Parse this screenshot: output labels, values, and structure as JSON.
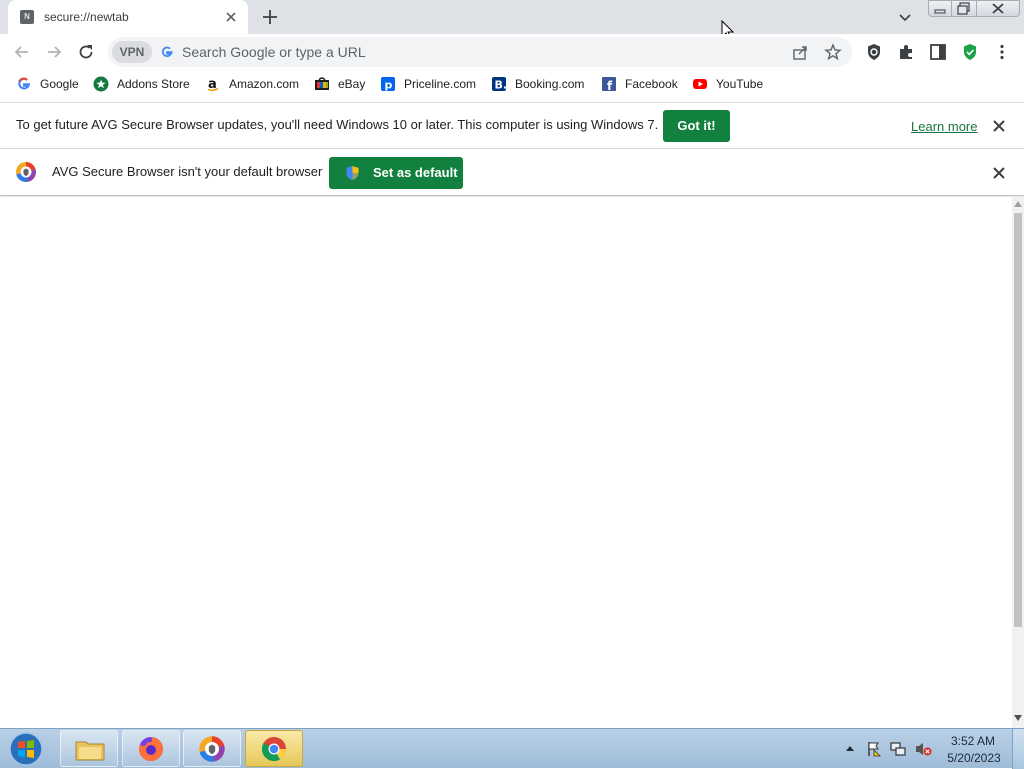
{
  "tab": {
    "title": "secure://newtab",
    "favicon_letter": "N"
  },
  "omnibox": {
    "vpn_label": "VPN",
    "placeholder": "Search Google or type a URL"
  },
  "bookmarks": [
    {
      "label": "Google",
      "icon": "google-icon"
    },
    {
      "label": "Addons Store",
      "icon": "addons-store-icon"
    },
    {
      "label": "Amazon.com",
      "icon": "amazon-icon"
    },
    {
      "label": "eBay",
      "icon": "ebay-icon"
    },
    {
      "label": "Priceline.com",
      "icon": "priceline-icon"
    },
    {
      "label": "Booking.com",
      "icon": "booking-icon"
    },
    {
      "label": "Facebook",
      "icon": "facebook-icon"
    },
    {
      "label": "YouTube",
      "icon": "youtube-icon"
    }
  ],
  "infobar_update": {
    "message": "To get future AVG Secure Browser updates, you'll need Windows 10 or later. This computer is using Windows 7.",
    "button": "Got it!",
    "link": "Learn more"
  },
  "infobar_default": {
    "message": "AVG Secure Browser isn't your default browser",
    "button": "Set as default"
  },
  "taskbar": {
    "time": "3:52 AM",
    "date": "5/20/2023",
    "apps": [
      "explorer-icon",
      "firefox-icon",
      "avg-browser-icon",
      "chrome-icon"
    ]
  },
  "colors": {
    "accent_green": "#12813f",
    "tabstrip": "#dee1e6",
    "omnibox_bg": "#f1f3f4",
    "link": "#1a7340"
  }
}
